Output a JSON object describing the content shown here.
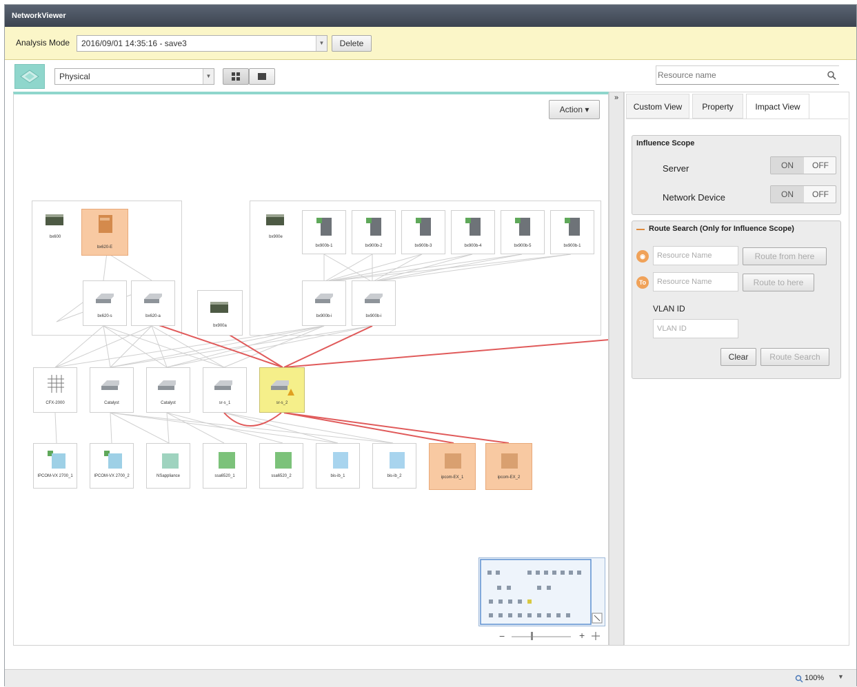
{
  "window": {
    "title": "NetworkViewer"
  },
  "mode_bar": {
    "label": "Analysis Mode",
    "selected": "2016/09/01 14:35:16 - save3",
    "delete_label": "Delete"
  },
  "toolbar": {
    "view_selected": "Physical",
    "search_placeholder": "Resource name"
  },
  "canvas": {
    "action_label": "Action ▾",
    "zoom_minus": "−",
    "zoom_plus": "+",
    "nodes": [
      {
        "id": "n1",
        "label": "bx600"
      },
      {
        "id": "n2",
        "label": "bx620-E"
      },
      {
        "id": "n3",
        "label": "bx620-s"
      },
      {
        "id": "n4",
        "label": "bx620-a"
      },
      {
        "id": "n5",
        "label": "bx900a"
      },
      {
        "id": "n6",
        "label": "bx900e"
      },
      {
        "id": "n7",
        "label": "bx900b-1"
      },
      {
        "id": "n8",
        "label": "bx900b-2"
      },
      {
        "id": "n9",
        "label": "bx900b-3"
      },
      {
        "id": "n10",
        "label": "bx900b-4"
      },
      {
        "id": "n11",
        "label": "bx900b-5"
      },
      {
        "id": "n12",
        "label": "bx900b-1"
      },
      {
        "id": "n13",
        "label": "bx900b-i"
      },
      {
        "id": "n14",
        "label": "bx900b-i"
      },
      {
        "id": "n15",
        "label": "CFX-2000"
      },
      {
        "id": "n16",
        "label": "Catalyst"
      },
      {
        "id": "n17",
        "label": "Catalyst"
      },
      {
        "id": "n18",
        "label": "sr-s_1"
      },
      {
        "id": "n19",
        "label": "sr-s_2"
      },
      {
        "id": "n20",
        "label": "IPCOM-VX 2700_1"
      },
      {
        "id": "n21",
        "label": "IPCOM-VX 2700_2"
      },
      {
        "id": "n22",
        "label": "NSappliance"
      },
      {
        "id": "n23",
        "label": "ssa6520_1"
      },
      {
        "id": "n24",
        "label": "ssa6520_2"
      },
      {
        "id": "n25",
        "label": "bis-ib_1"
      },
      {
        "id": "n26",
        "label": "bis-ib_2"
      },
      {
        "id": "n27",
        "label": "ipcom-EX_1"
      },
      {
        "id": "n28",
        "label": "ipcom-EX_2"
      }
    ]
  },
  "panel": {
    "tabs": [
      {
        "label": "Custom View"
      },
      {
        "label": "Property"
      },
      {
        "label": "Impact View"
      }
    ],
    "influence": {
      "title": "Influence Scope",
      "server_label": "Server",
      "network_label": "Network Device",
      "on": "ON",
      "off": "OFF"
    },
    "route": {
      "title": "Route Search (Only for Influence Scope)",
      "from_placeholder": "Resource Name",
      "to_placeholder": "Resource Name",
      "from_btn": "Route from here",
      "to_btn": "Route to here",
      "vlan_label": "VLAN ID",
      "vlan_placeholder": "VLAN ID",
      "clear_btn": "Clear",
      "search_btn": "Route Search",
      "from_pin": "◉",
      "to_pin": "To"
    }
  },
  "status": {
    "zoom": "100%"
  },
  "icons": {
    "search": "search-icon",
    "grid": "grid-view-icon",
    "list": "list-view-icon",
    "collapse": "collapse-icon"
  }
}
